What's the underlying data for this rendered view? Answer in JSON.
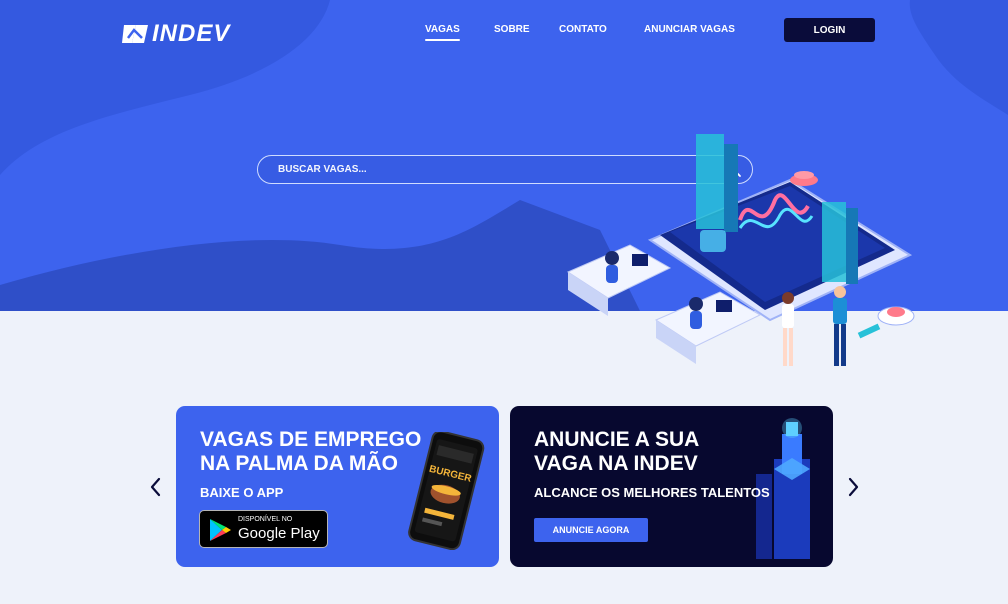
{
  "brand": {
    "name": "INDEV"
  },
  "nav": {
    "items": [
      {
        "label": "VAGAS",
        "active": true
      },
      {
        "label": "SOBRE"
      },
      {
        "label": "CONTATO"
      },
      {
        "label": "ANUNCIAR VAGAS"
      }
    ],
    "login_label": "LOGIN"
  },
  "search": {
    "placeholder": "BUSCAR VAGAS..."
  },
  "carousel": {
    "slides": [
      {
        "title_line1": "VAGAS DE EMPREGO",
        "title_line2": "NA PALMA DA MÃO",
        "subtitle": "BAIXE O APP",
        "badge_small": "DISPONÍVEL NO",
        "badge_big": "Google Play",
        "phone_text": "BURGER"
      },
      {
        "title_line1": "ANUNCIE A SUA",
        "title_line2": "VAGA NA INDEV",
        "subtitle": "ALCANCE OS MELHORES TALENTOS",
        "cta_label": "ANUNCIE AGORA"
      }
    ]
  },
  "colors": {
    "primary": "#3d63ee",
    "dark": "#07082f",
    "background": "#eef2fa"
  },
  "icons": {
    "prev": "chevron-left-icon",
    "next": "chevron-right-icon",
    "search": "search-icon"
  }
}
